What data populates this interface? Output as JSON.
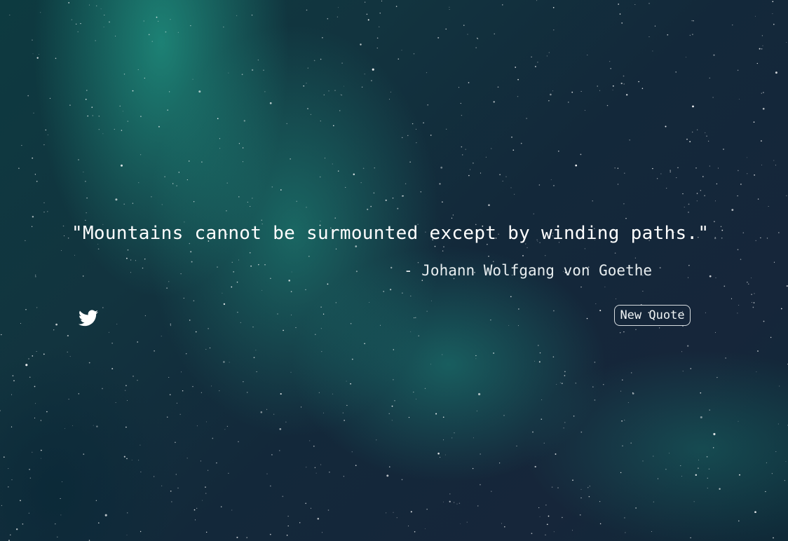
{
  "quote": {
    "text": "\"Mountains cannot be surmounted except by winding paths.\"",
    "author": "- Johann Wolfgang von Goethe"
  },
  "actions": {
    "tweet_icon": "twitter-bird",
    "new_quote_label": "New Quote"
  },
  "colors": {
    "text": "#ffffff",
    "button_border": "#d8dde0",
    "aurora": "#28be9f",
    "sky": "#13283a"
  }
}
